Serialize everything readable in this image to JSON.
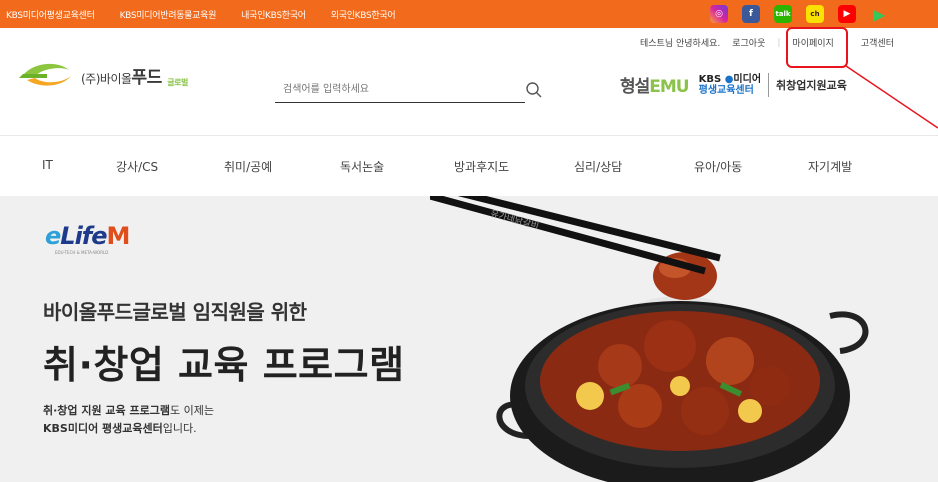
{
  "topbar": {
    "links": [
      "KBS미디어평생교육센터",
      "KBS미디어반려동물교육원",
      "내국인KBS한국어",
      "외국인KBS한국어"
    ],
    "social": [
      "instagram-icon",
      "facebook-icon",
      "talk-icon",
      "kakao-icon",
      "youtube-icon",
      "playstore-icon"
    ]
  },
  "util": {
    "greeting": "테스트님 안녕하세요.",
    "logout": "로그아웃",
    "mypage": "마이페이지",
    "support": "고객센터"
  },
  "logo": {
    "corp": "(주)바이올",
    "brand": "푸드",
    "sub": "글로벌"
  },
  "search": {
    "placeholder": "검색어를 입력하세요"
  },
  "partners": {
    "emu_prefix": "형설",
    "emu_brand": "EMU",
    "kbs_top": "KBS",
    "kbs_mid": "미디어",
    "kbs_bottom": "평생교육센터",
    "job": "취창업지원교육"
  },
  "nav": [
    "IT",
    "강사/CS",
    "취미/공예",
    "독서논술",
    "방과후지도",
    "심리/상담",
    "유아/아동",
    "자기계발"
  ],
  "hero": {
    "logo_e": "e",
    "logo_life": "Life",
    "logo_m": "M",
    "logo_sub": "EDU-TECH & META-WORLD",
    "line1": "바이올푸드글로벌 임직원을 위한",
    "line2": "취·창업 교육 프로그램",
    "desc1_bold": "취·창업 지원 교육 프로그램",
    "desc1_rest": "도 이제는",
    "desc2_bold": "KBS미디어 평생교육센터",
    "desc2_rest": "입니다.",
    "chopstick_text": "유가네닭갈비"
  },
  "colors": {
    "brand_orange": "#f26a1b",
    "annotation_red": "#e8131b"
  }
}
